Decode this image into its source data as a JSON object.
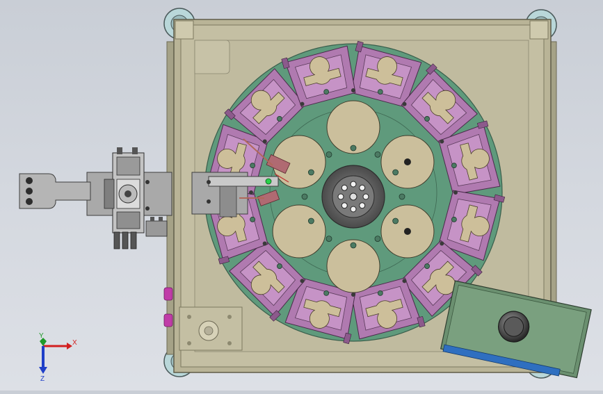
{
  "window": {
    "title": ""
  },
  "triad": {
    "x_label": "X",
    "y_label": "Y",
    "z_label": "Z",
    "colors": {
      "x": "#d21f1f",
      "y": "#1f9a2a",
      "z": "#1f3fc8"
    }
  },
  "colors": {
    "frame": "#b9b497",
    "frame_edge": "#7c785f",
    "table": "#5f9a7c",
    "fixture": "#b07ab0",
    "fixture_pocket": "#cdbf9a",
    "disc": "#cbbf9c",
    "hub": "#5a5a5a",
    "feeder": "#a9a9a9",
    "cover": "#6b9070",
    "cover_strip": "#2f6fc0",
    "caster": "#b9d7d9"
  }
}
